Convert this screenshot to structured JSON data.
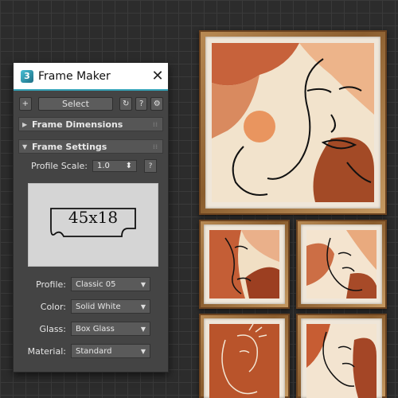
{
  "panel": {
    "title": "Frame Maker",
    "logo_glyph": "3",
    "close_glyph": "✕",
    "toolbar": {
      "add_glyph": "+",
      "select_label": "Select",
      "refresh_glyph": "↻",
      "help_glyph": "?",
      "settings_glyph": "⚙"
    },
    "rollouts": {
      "dimensions": {
        "label": "Frame Dimensions",
        "arrow": "▶"
      },
      "settings": {
        "label": "Frame Settings",
        "arrow": "▼"
      }
    },
    "profile_scale": {
      "label": "Profile Scale:",
      "value": "1.0",
      "spin_glyph": "⬍",
      "help_glyph": "?"
    },
    "profile_preview": {
      "text": "45x18"
    },
    "fields": {
      "profile": {
        "label": "Profile:",
        "value": "Classic 05"
      },
      "color": {
        "label": "Color:",
        "value": "Solid White"
      },
      "glass": {
        "label": "Glass:",
        "value": "Box Glass"
      },
      "material": {
        "label": "Material:",
        "value": "Standard"
      }
    },
    "caret_glyph": "▼"
  },
  "icons": [
    "app-logo-icon",
    "close-icon",
    "plus-icon",
    "refresh-icon",
    "help-icon",
    "settings-icon",
    "expand-arrow-icon",
    "collapse-arrow-icon",
    "spinner-icon",
    "dropdown-caret-icon"
  ],
  "colors": {
    "accent": "#35a3b8",
    "panel_bg": "#444444",
    "frame_wood": "#a57844",
    "art_terracotta": "#b5562d",
    "art_peach": "#e9a97a"
  }
}
